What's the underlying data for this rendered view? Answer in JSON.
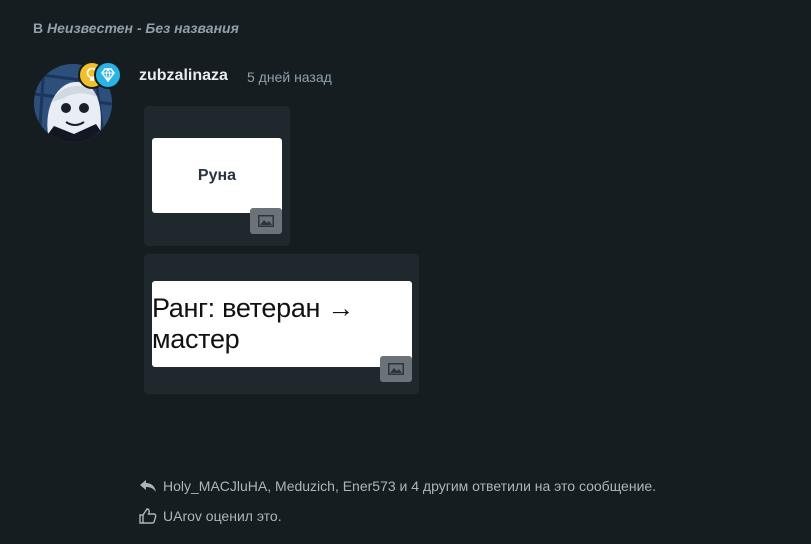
{
  "location": {
    "prefix": "В",
    "name": "Неизвестен - Без названия"
  },
  "post": {
    "username": "zubzalinaza",
    "timestamp": "5 дней назад",
    "avatar_icon": "avatar-image",
    "badges": [
      {
        "icon": "lightbulb-icon",
        "color": "#f3c02b"
      },
      {
        "icon": "diamond-icon",
        "color": "#2ab3e6"
      }
    ],
    "attachments": [
      {
        "text": "Руна",
        "icon": "image-icon"
      },
      {
        "text": "Ранг: ветеран → мастер",
        "icon": "image-icon"
      }
    ]
  },
  "activity": {
    "replies": "Holy_MACJluHA, Meduzich, Ener573 и 4 другим ответили на это сообщение.",
    "likes": "UArov оценил это."
  }
}
